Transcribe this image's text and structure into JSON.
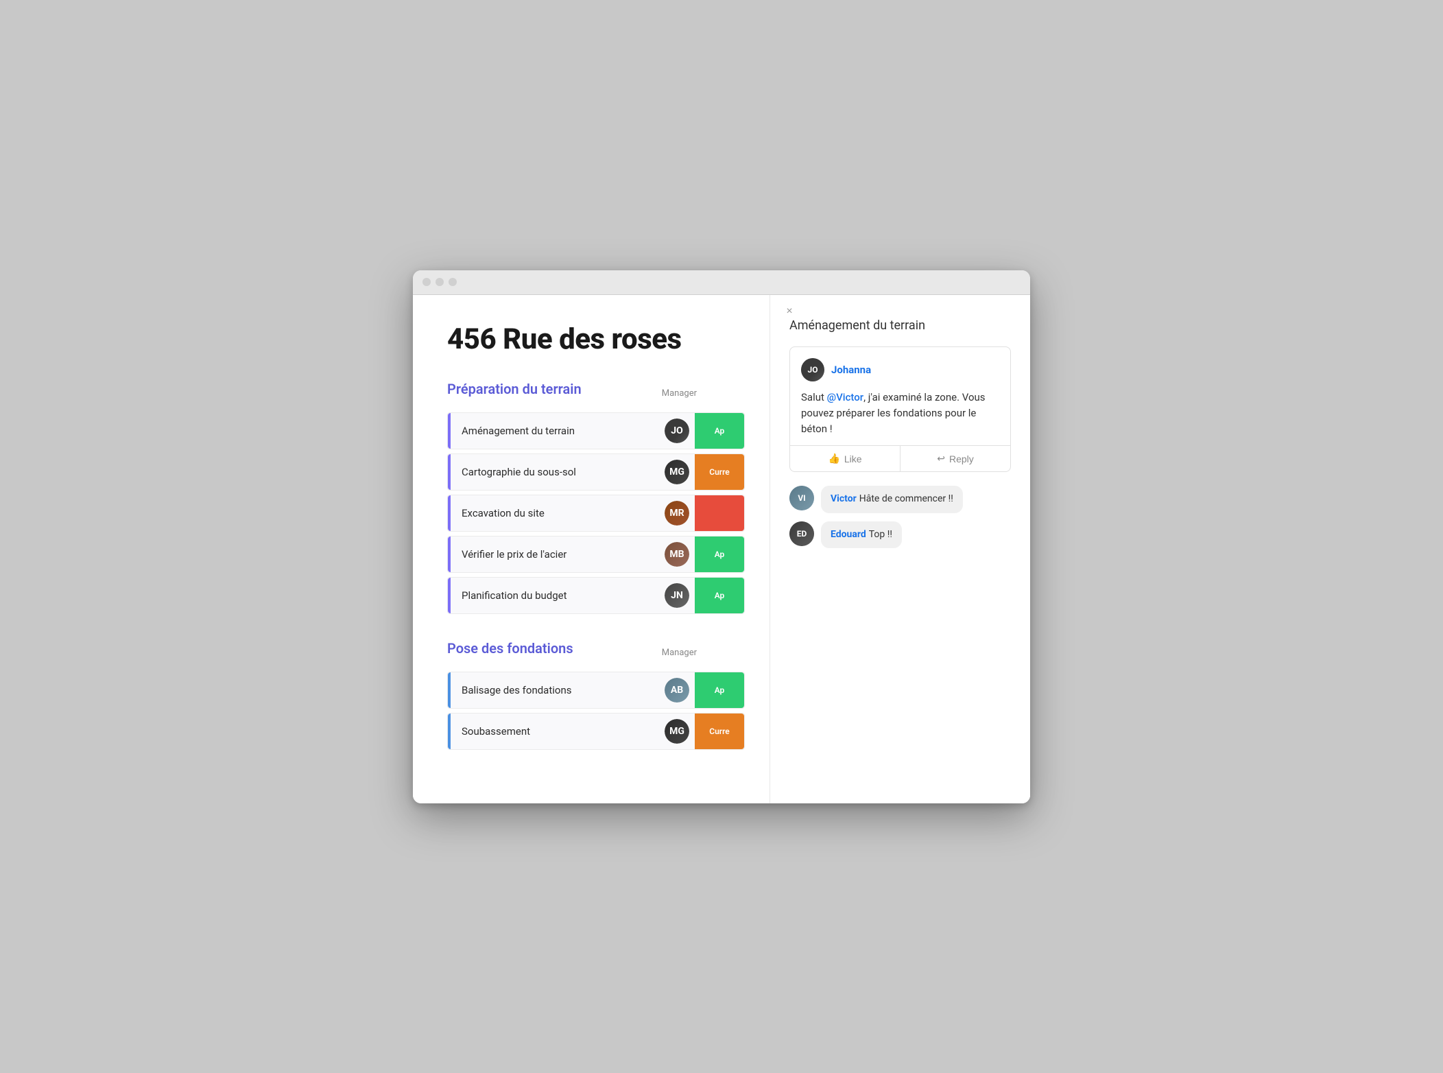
{
  "browser": {
    "traffic_lights": [
      "close",
      "minimize",
      "maximize"
    ]
  },
  "page": {
    "title": "456 Rue des roses"
  },
  "sections": [
    {
      "id": "preparation",
      "title": "Préparation du terrain",
      "manager_label": "Manager",
      "accent_color": "purple",
      "tasks": [
        {
          "name": "Aménagement du terrain",
          "manager_initials": "JO",
          "manager_color": "face-johanna",
          "status": "Ap",
          "status_class": "status-approved"
        },
        {
          "name": "Cartographie du sous-sol",
          "manager_initials": "MG",
          "manager_color": "face-manager1",
          "status": "Curre",
          "status_class": "status-current"
        },
        {
          "name": "Excavation du site",
          "manager_initials": "MR",
          "manager_color": "face-manager2",
          "status": "",
          "status_class": "status-red"
        },
        {
          "name": "Vérifier le prix de l'acier",
          "manager_initials": "MB",
          "manager_color": "face-manager3",
          "status": "Ap",
          "status_class": "status-approved"
        },
        {
          "name": "Planification du budget",
          "manager_initials": "JN",
          "manager_color": "face-manager4",
          "status": "Ap",
          "status_class": "status-approved"
        }
      ]
    },
    {
      "id": "fondations",
      "title": "Pose des fondations",
      "manager_label": "Manager",
      "accent_color": "blue",
      "tasks": [
        {
          "name": "Balisage des fondations",
          "manager_initials": "AB",
          "manager_color": "face-victor",
          "status": "Ap",
          "status_class": "status-approved"
        },
        {
          "name": "Soubassement",
          "manager_initials": "MG",
          "manager_color": "face-manager1",
          "status": "Curre",
          "status_class": "status-current"
        }
      ]
    }
  ],
  "drawer": {
    "title": "Aménagement du terrain",
    "close_symbol": "×",
    "comment": {
      "author": "Johanna",
      "author_color": "face-johanna",
      "author_initials": "JO",
      "text_parts": [
        {
          "type": "text",
          "value": "Salut "
        },
        {
          "type": "mention",
          "value": "@Victor"
        },
        {
          "type": "text",
          "value": ", j'ai examiné la zone. Vous pouvez préparer les fondations pour le béton !"
        }
      ],
      "like_label": "Like",
      "reply_label": "Reply"
    },
    "replies": [
      {
        "author": "Victor",
        "initials": "VI",
        "color": "face-victor",
        "text": "Hâte de commencer !!"
      },
      {
        "author": "Edouard",
        "initials": "ED",
        "color": "face-edouard",
        "text": "Top !!"
      }
    ]
  }
}
